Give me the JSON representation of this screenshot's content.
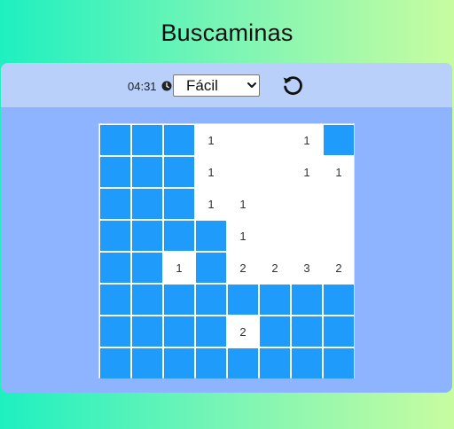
{
  "title": "Buscaminas",
  "toolbar": {
    "timer": "04:31",
    "timer_icon": "clock-icon",
    "difficulty": {
      "selected": "Fácil",
      "options": [
        "Fácil"
      ]
    },
    "reset_icon": "restart-icon"
  },
  "colors": {
    "hidden_cell": "#1e9bfb",
    "panel": "#8fb4ff",
    "toolbar": "#b9d0fb"
  },
  "board": {
    "rows": 8,
    "cols": 8,
    "cells": [
      [
        "H",
        "H",
        "H",
        "1",
        "",
        "",
        "1",
        "H"
      ],
      [
        "H",
        "H",
        "H",
        "1",
        "",
        "",
        "1",
        "1"
      ],
      [
        "H",
        "H",
        "H",
        "1",
        "1",
        "",
        "",
        ""
      ],
      [
        "H",
        "H",
        "H",
        "H",
        "1",
        "",
        "",
        ""
      ],
      [
        "H",
        "H",
        "1",
        "H",
        "2",
        "2",
        "3",
        "2"
      ],
      [
        "H",
        "H",
        "H",
        "H",
        "H",
        "H",
        "H",
        "H"
      ],
      [
        "H",
        "H",
        "H",
        "H",
        "2",
        "H",
        "H",
        "H"
      ],
      [
        "H",
        "H",
        "H",
        "H",
        "H",
        "H",
        "H",
        "H"
      ]
    ]
  }
}
